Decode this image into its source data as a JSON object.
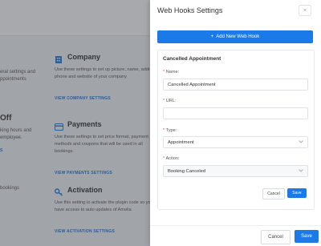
{
  "background": {
    "left_fragments": {
      "line_general_a": "eral settings and",
      "line_general_b": "ppointments",
      "off_title": "Off",
      "off_line_a": "king hours and",
      "off_line_b": " employee.",
      "off_link": "S",
      "bookings": " bookings"
    },
    "sections": {
      "company": {
        "title": "Company",
        "desc": "Use these settings to set up picture, name, address, phone and website of your company",
        "link": "VIEW COMPANY SETTINGS"
      },
      "payments": {
        "title": "Payments",
        "desc": "Use these settings to set price format, payment methods and coupons that will be used in all bookings.",
        "link": "VIEW PAYMENTS SETTINGS"
      },
      "activation": {
        "title": "Activation",
        "desc": "Use this setting to activate the plugin code so you have access to auto updates of Amelia",
        "link": "VIEW ACTIVATION SETTINGS"
      }
    }
  },
  "dialog": {
    "title": "Web Hooks Settings",
    "close_symbol": "×",
    "add_button": "Add New Web Hook",
    "add_symbol": "+",
    "webhook": {
      "title": "Cancelled Appointment",
      "name_label": "Name:",
      "name_value": "Cancelled Appointment",
      "url_label": "URL:",
      "url_value": "",
      "type_label": "Type:",
      "type_value": "Appointment",
      "action_label": "Action:",
      "action_value": "Booking Canceled",
      "required_mark": "*",
      "cancel": "Cancel",
      "save": "Save"
    },
    "footer": {
      "cancel": "Cancel",
      "save": "Save"
    }
  },
  "colors": {
    "accent": "#1a7ae8",
    "overlay": "#3c4046"
  }
}
